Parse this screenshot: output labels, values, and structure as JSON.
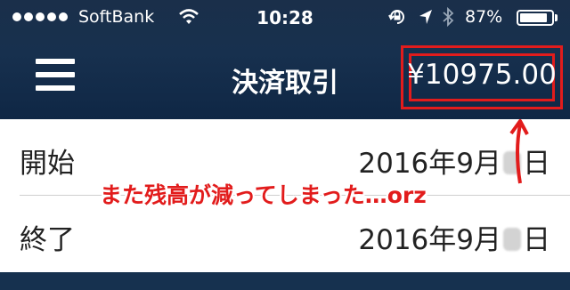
{
  "status_bar": {
    "carrier": "SoftBank",
    "time": "10:28",
    "battery_percent": "87%",
    "battery_level": 0.87,
    "icons": [
      "wifi-icon",
      "orientation-lock-icon",
      "location-arrow-icon",
      "bluetooth-icon",
      "battery-icon"
    ]
  },
  "header": {
    "title": "決済取引",
    "balance": "¥10975.00",
    "highlight_color": "#e21c1c"
  },
  "rows": [
    {
      "label": "開始",
      "value_prefix": "2016年9月",
      "value_suffix": "日"
    },
    {
      "label": "終了",
      "value_prefix": "2016年9月",
      "value_suffix": "日"
    }
  ],
  "annotation": {
    "text": "また残高が減ってしまった…orz",
    "color": "#e21c1c"
  }
}
